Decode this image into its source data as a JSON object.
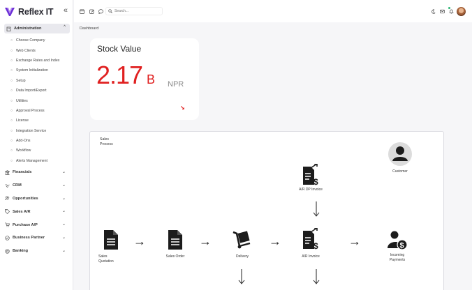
{
  "brand": {
    "name": "Reflex IT",
    "collapse": "«"
  },
  "sidebar": {
    "admin": {
      "label": "Administration",
      "chevron": "^"
    },
    "sub_items": [
      "Choose Company",
      "Web Clients",
      "Exchange Rates and Index",
      "System Initialization",
      "Setup",
      "Data Import/Export",
      "Utilities",
      "Approval Process",
      "License",
      "Integration Service",
      "Add-Ons",
      "Workflow",
      "Alerts Management"
    ],
    "menu": [
      {
        "label": "Financials"
      },
      {
        "label": "CRM"
      },
      {
        "label": "Opportunities"
      },
      {
        "label": "Sales A/R"
      },
      {
        "label": "Purchase A/P"
      },
      {
        "label": "Business Partner"
      },
      {
        "label": "Banking"
      }
    ]
  },
  "topbar": {
    "search_placeholder": "Search..."
  },
  "breadcrumb": "Dashboard",
  "stock": {
    "title": "Stock Value",
    "value": "2.17",
    "suffix": "B",
    "unit": "NPR",
    "trend": "↘"
  },
  "process": {
    "title": "Sales Process",
    "nodes": {
      "customer": "Customer",
      "ar_dp_invoice": "A/R DP Invoice",
      "sales_quotation": "Sales Quotation",
      "sales_order": "Sales Order",
      "delivery": "Delivery",
      "ar_invoice": "A/R Invoice",
      "incoming_payments": "Incoming Payments"
    },
    "arrow": "→"
  },
  "colors": {
    "accent": "#6b2fd6",
    "stock_red": "#e02020",
    "green": "#2bb673"
  }
}
